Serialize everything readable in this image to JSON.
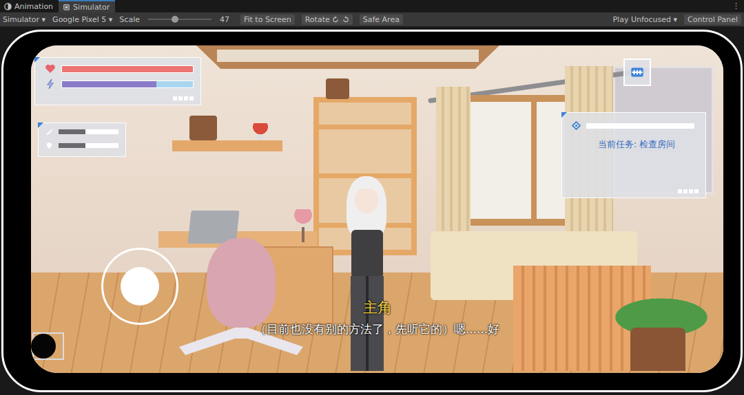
{
  "editor": {
    "tabs": [
      {
        "label": "Animation",
        "selected": false,
        "kind": "animation"
      },
      {
        "label": "Simulator",
        "selected": true,
        "kind": "simulator"
      }
    ],
    "menu": "⋮",
    "toolbar": {
      "mode": "Simulator ▾",
      "device": "Google Pixel 5 ▾",
      "scale_label": "Scale",
      "scale": {
        "level": 0.42,
        "reading": "47"
      },
      "fit": "Fit to Screen",
      "rotate": "Rotate",
      "safe_area": "Safe Area",
      "play_mode": "Play Unfocused ▾",
      "control_panel": "Control Panel"
    }
  },
  "hud": {
    "health": {
      "level": 1.0
    },
    "energy": {
      "level": 0.72
    },
    "stats": [
      {
        "level": 0.45
      },
      {
        "level": 0.45
      }
    ],
    "task": {
      "label": "当前任务: 检查房间"
    },
    "dialogue": {
      "speaker": "主角",
      "line": "（目前也没有别的方法了，先听它的）嗯......好"
    }
  }
}
